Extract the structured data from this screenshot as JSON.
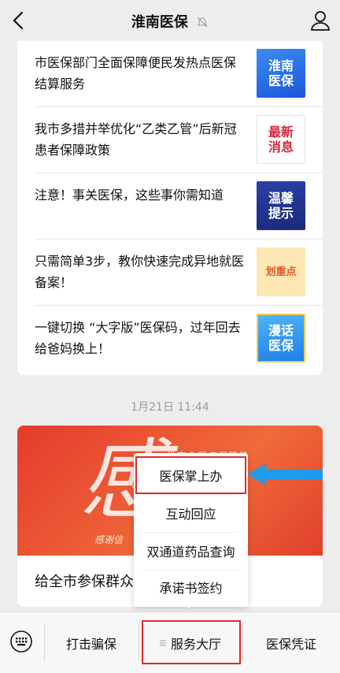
{
  "header": {
    "back_icon": "chevron-left-icon",
    "title": "淮南医保",
    "mute_icon": "bell-muted-icon",
    "profile_icon": "person-icon"
  },
  "articles": [
    {
      "title": "市医保部门全面保障便民发热点医保结算服务",
      "thumb_lines": [
        "淮南",
        "医保"
      ]
    },
    {
      "title": "我市多措并举优化“乙类乙管”后新冠患者保障政策",
      "thumb_lines": [
        "最新",
        "消息"
      ]
    },
    {
      "title": "注意！事关医保，这些事你需知道",
      "thumb_lines": [
        "温馨",
        "提示"
      ]
    },
    {
      "title": "只需简单3步，教你快速完成异地就医备案！",
      "thumb_lines": [
        "划重点",
        ""
      ]
    },
    {
      "title": "一键切换 “大字版”医保码，过年回去给爸妈换上！",
      "thumb_lines": [
        "漫话",
        "医保"
      ]
    }
  ],
  "timestamp": "1月21日 11:44",
  "second_card": {
    "banner_script": "感",
    "banner_org": "淮南市医疗保障局",
    "banner_thanks": "感谢信",
    "title": "给全市参保群众"
  },
  "popup_menu": {
    "items": [
      "医保掌上办",
      "互动回应",
      "双通道药品查询",
      "承诺书签约"
    ],
    "highlighted_index": 0
  },
  "annotation": {
    "arrow_color": "#1e9bea",
    "highlight_color": "#e02a2a"
  },
  "bottom_menu": {
    "keyboard_icon": "keyboard-icon",
    "items": [
      "打击骗保",
      "服务大厅",
      "医保凭证"
    ],
    "active_index": 1,
    "menu_icon": "menu-lines-icon"
  }
}
